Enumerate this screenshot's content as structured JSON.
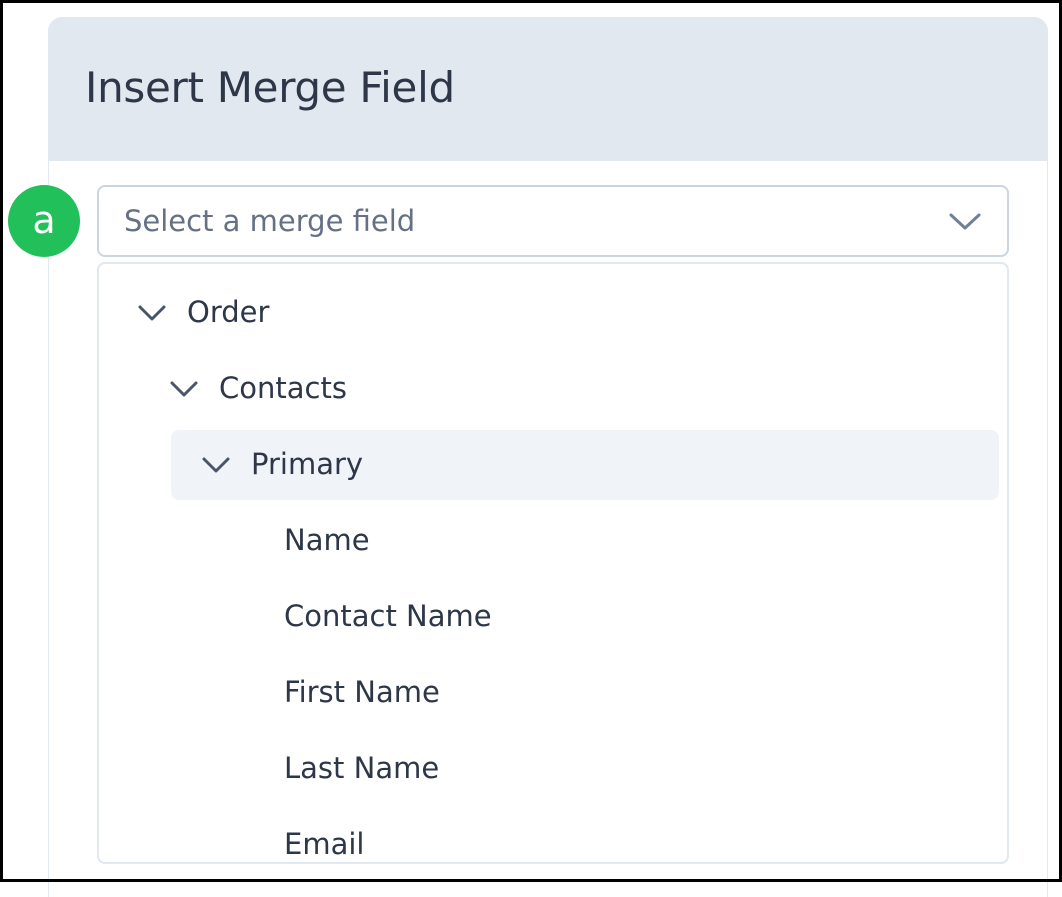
{
  "dialog": {
    "title": "Insert Merge Field"
  },
  "badge": {
    "label": "a",
    "color": "#22c05a"
  },
  "select": {
    "placeholder": "Select a merge field",
    "chevron_icon": "chevron-down-icon"
  },
  "tree": {
    "order": {
      "label": "Order",
      "expanded": true
    },
    "contacts": {
      "label": "Contacts",
      "expanded": true
    },
    "primary": {
      "label": "Primary",
      "expanded": true,
      "selected": true
    },
    "fields": [
      {
        "label": "Name"
      },
      {
        "label": "Contact Name"
      },
      {
        "label": "First Name"
      },
      {
        "label": "Last Name"
      },
      {
        "label": "Email"
      }
    ]
  }
}
